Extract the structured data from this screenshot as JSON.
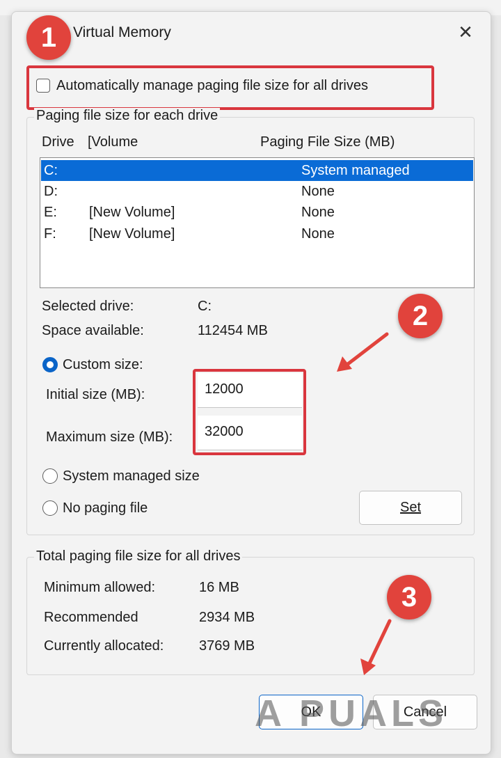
{
  "dialog": {
    "title": "Virtual Memory",
    "close_glyph": "✕"
  },
  "auto_manage": {
    "label": "Automatically manage paging file size for all drives",
    "checked": false
  },
  "paging_group": {
    "label": "Paging file size for each drive",
    "columns": [
      "Drive",
      "[Volume",
      "Paging File Size (MB)"
    ],
    "rows": [
      {
        "drive": "C:",
        "volume": "",
        "size": "System managed",
        "selected": true
      },
      {
        "drive": "D:",
        "volume": "",
        "size": "None",
        "selected": false
      },
      {
        "drive": "E:",
        "volume": "[New Volume]",
        "size": "None",
        "selected": false
      },
      {
        "drive": "F:",
        "volume": "[New Volume]",
        "size": "None",
        "selected": false
      }
    ],
    "selected_drive_label": "Selected drive:",
    "selected_drive_value": "C:",
    "space_label": "Space available:",
    "space_value": "112454 MB",
    "custom_label": "Custom size:",
    "initial_label": "Initial size (MB):",
    "initial_value": "12000",
    "maximum_label": "Maximum size (MB):",
    "maximum_value": "32000",
    "system_managed_label": "System managed size",
    "no_paging_label": "No paging file",
    "set_label": "Set",
    "selected_option": "custom"
  },
  "total_group": {
    "label": "Total paging file size for all drives",
    "minimum_label": "Minimum allowed:",
    "minimum_value": "16 MB",
    "recommended_label": "Recommended",
    "recommended_value": "2934 MB",
    "allocated_label": "Currently allocated:",
    "allocated_value": "3769 MB"
  },
  "buttons": {
    "ok": "OK",
    "cancel": "Cancel"
  },
  "annotations": {
    "step1": "1",
    "step2": "2",
    "step3": "3",
    "color": "#e1433c"
  },
  "watermark": "A  PUALS",
  "colors": {
    "accent": "#0a6bd6",
    "highlight_box": "#d9363e"
  }
}
